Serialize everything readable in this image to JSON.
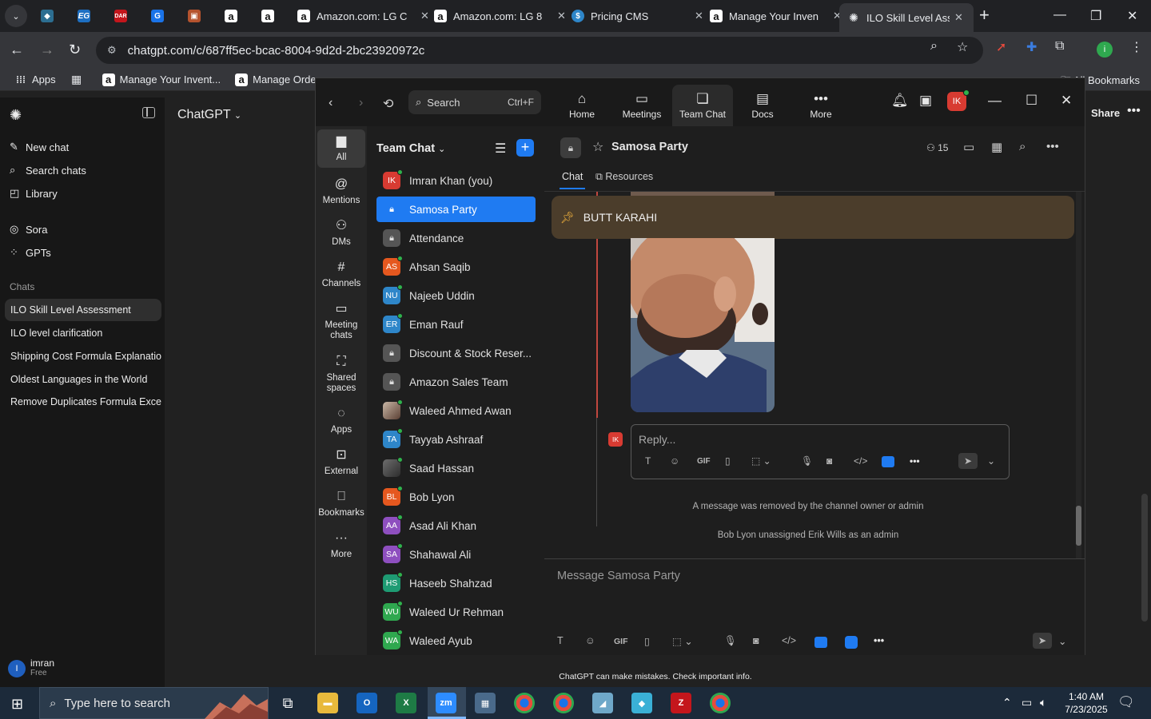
{
  "browser": {
    "pinned_tabs": [
      {
        "icon": "kinsta-icon",
        "color": "#3a8fb7",
        "glyph": ""
      },
      {
        "icon": "eg-icon",
        "color": "#1d6fc2",
        "glyph": "EG"
      },
      {
        "icon": "daraz-icon",
        "color": "#c4161c",
        "glyph": "DAR"
      },
      {
        "icon": "docs-icon",
        "color": "#1a73e8",
        "glyph": "G"
      },
      {
        "icon": "box-icon",
        "color": "#b5532e",
        "glyph": "▣"
      },
      {
        "icon": "amazon-icon",
        "color": "#ffffff",
        "glyph": "a"
      },
      {
        "icon": "amazon-icon",
        "color": "#ffffff",
        "glyph": "a"
      }
    ],
    "tabs": [
      {
        "title": "Amazon.com: LG C",
        "icon": "amazon-icon"
      },
      {
        "title": "Amazon.com: LG 8",
        "icon": "amazon-icon"
      },
      {
        "title": "Pricing CMS",
        "icon": "dollar-icon"
      },
      {
        "title": "Manage Your Inven",
        "icon": "amazon-icon"
      },
      {
        "title": "ILO Skill Level Asse",
        "icon": "openai-icon",
        "active": true
      }
    ],
    "url": "chatgpt.com/c/687ff5ec-bcac-8004-9d2d-2bc23920972c",
    "bookmarks": [
      {
        "label": "Apps",
        "icon": "apps-grid-icon"
      },
      {
        "label": "",
        "icon": "grid-icon"
      },
      {
        "label": "Manage Your Invent...",
        "icon": "amazon-icon"
      },
      {
        "label": "Manage Orders",
        "icon": "amazon-icon"
      }
    ],
    "all_bookmarks": "All Bookmarks"
  },
  "chatgpt": {
    "app_title": "ChatGPT",
    "nav": [
      {
        "label": "New chat",
        "icon": "new-chat-icon"
      },
      {
        "label": "Search chats",
        "icon": "search-icon"
      },
      {
        "label": "Library",
        "icon": "library-icon"
      },
      {
        "label": "Sora",
        "icon": "sora-icon"
      },
      {
        "label": "GPTs",
        "icon": "gpts-icon"
      }
    ],
    "chats_label": "Chats",
    "chats": [
      "ILO Skill Level Assessment",
      "ILO level clarification",
      "Shipping Cost Formula Explanation",
      "Oldest Languages in the World",
      "Remove Duplicates Formula Excel"
    ],
    "user": {
      "initial": "I",
      "name": "imran",
      "plan": "Free"
    },
    "share": "Share",
    "footer": "ChatGPT can make mistakes. Check important info."
  },
  "zoom": {
    "search_label": "Search",
    "search_shortcut": "Ctrl+F",
    "top_tabs": [
      {
        "label": "Home",
        "icon": "home-icon"
      },
      {
        "label": "Meetings",
        "icon": "video-icon"
      },
      {
        "label": "Team Chat",
        "icon": "chat-icon",
        "active": true
      },
      {
        "label": "Docs",
        "icon": "docs-icon"
      },
      {
        "label": "More",
        "icon": "more-icon"
      }
    ],
    "profile_initials": "IK",
    "rail": [
      {
        "label": "All",
        "icon": "chat-bubble-icon",
        "active": true
      },
      {
        "label": "Mentions",
        "icon": "at-icon"
      },
      {
        "label": "DMs",
        "icon": "people-icon"
      },
      {
        "label": "Channels",
        "icon": "hash-icon"
      },
      {
        "label": "Meeting chats",
        "icon": "calendar-icon"
      },
      {
        "label": "Shared spaces",
        "icon": "shared-icon"
      },
      {
        "label": "Apps",
        "icon": "apps-icon"
      },
      {
        "label": "External",
        "icon": "external-icon"
      },
      {
        "label": "Bookmarks",
        "icon": "bookmark-icon"
      },
      {
        "label": "More",
        "icon": "more-icon"
      }
    ],
    "list_title": "Team Chat",
    "conversations": [
      {
        "name": "Imran Khan (you)",
        "initials": "IK",
        "color": "#d83b32",
        "online": true
      },
      {
        "name": "Samosa Party",
        "lock": true,
        "active": true
      },
      {
        "name": "Attendance",
        "lock": true
      },
      {
        "name": "Ahsan Saqib",
        "initials": "AS",
        "color": "#e5581f",
        "online": true
      },
      {
        "name": "Najeeb Uddin",
        "initials": "NU",
        "color": "#2e86c9",
        "online": true
      },
      {
        "name": "Eman Rauf",
        "initials": "ER",
        "color": "#2e86c9",
        "online": true
      },
      {
        "name": "Discount & Stock Reser...",
        "lock": true
      },
      {
        "name": "Amazon Sales Team",
        "lock": true
      },
      {
        "name": "Waleed Ahmed Awan",
        "initials": "",
        "color": "#8a6d5a",
        "online": true
      },
      {
        "name": "Tayyab Ashraaf",
        "initials": "TA",
        "color": "#2e86c9",
        "online": true
      },
      {
        "name": "Saad Hassan",
        "initials": "",
        "color": "#5a5a5a",
        "online": true
      },
      {
        "name": "Bob Lyon",
        "initials": "BL",
        "color": "#e5581f",
        "online": true
      },
      {
        "name": "Asad Ali Khan",
        "initials": "AA",
        "color": "#8e4fbf",
        "online": true
      },
      {
        "name": "Shahawal Ali",
        "initials": "SA",
        "color": "#8e4fbf",
        "online": true
      },
      {
        "name": "Haseeb Shahzad",
        "initials": "HS",
        "color": "#1e9b73",
        "online": true
      },
      {
        "name": "Waleed Ur Rehman",
        "initials": "WU",
        "color": "#2fa84f",
        "online": true
      },
      {
        "name": "Waleed Ayub",
        "initials": "WA",
        "color": "#2fa84f",
        "online": true
      }
    ],
    "channel": {
      "name": "Samosa Party",
      "member_count": "15",
      "sub_tabs": [
        "Chat",
        "Resources"
      ],
      "pinned": "BUTT KARAHI",
      "reply_placeholder": "Reply...",
      "reply_initials": "IK",
      "system_messages": [
        "A message was removed by the channel owner or admin",
        "Bob Lyon unassigned Erik Wills as an admin"
      ],
      "compose_placeholder": "Message Samosa Party",
      "toolbar_gif": "GIF"
    }
  },
  "taskbar": {
    "search_placeholder": "Type here to search",
    "time": "1:40 AM",
    "date": "7/23/2025"
  }
}
